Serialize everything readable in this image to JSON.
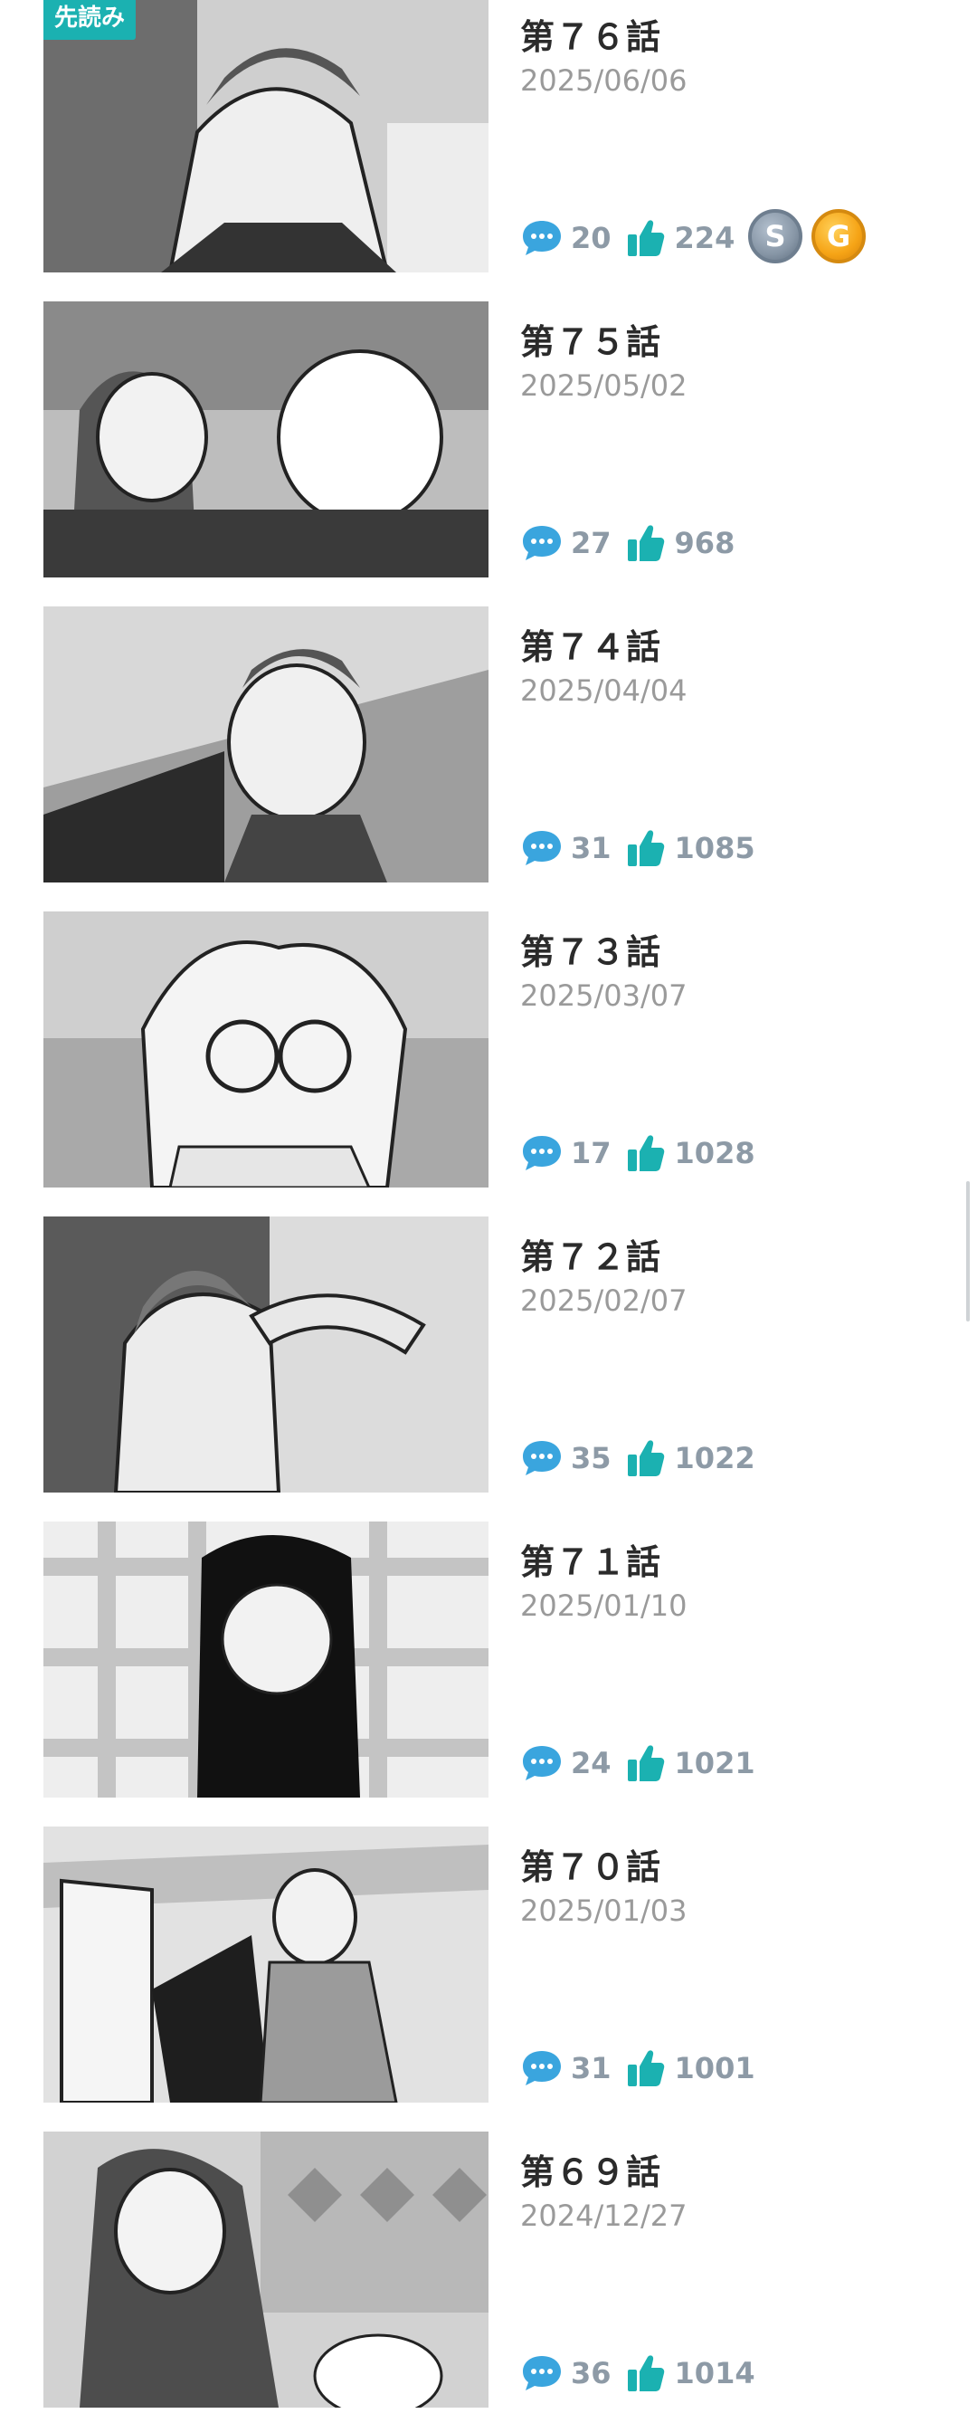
{
  "colors": {
    "accent": "#1bb1b1",
    "comment_icon": "#3aa5de",
    "like_icon": "#1bb1b1",
    "count_text": "#8d9aa6",
    "date_text": "#9a9a9a"
  },
  "icons": {
    "comment": "speech-bubble-icon",
    "like": "thumbs-up-icon"
  },
  "episodes": [
    {
      "badge": "先読み",
      "title": "第７６話",
      "date": "2025/06/06",
      "comments": "20",
      "likes": "224",
      "coins": [
        "S",
        "G"
      ]
    },
    {
      "title": "第７５話",
      "date": "2025/05/02",
      "comments": "27",
      "likes": "968"
    },
    {
      "title": "第７４話",
      "date": "2025/04/04",
      "comments": "31",
      "likes": "1085"
    },
    {
      "title": "第７３話",
      "date": "2025/03/07",
      "comments": "17",
      "likes": "1028"
    },
    {
      "title": "第７２話",
      "date": "2025/02/07",
      "comments": "35",
      "likes": "1022"
    },
    {
      "title": "第７１話",
      "date": "2025/01/10",
      "comments": "24",
      "likes": "1021"
    },
    {
      "title": "第７０話",
      "date": "2025/01/03",
      "comments": "31",
      "likes": "1001"
    },
    {
      "title": "第６９話",
      "date": "2024/12/27",
      "comments": "36",
      "likes": "1014"
    }
  ]
}
